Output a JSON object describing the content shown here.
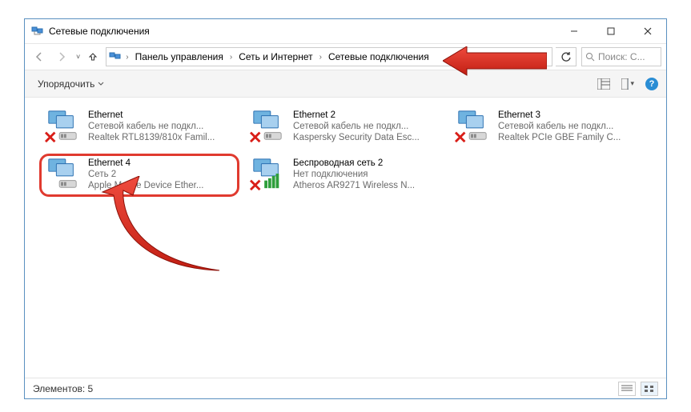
{
  "window": {
    "title": "Сетевые подключения"
  },
  "breadcrumb": {
    "root_sep": "›",
    "items": [
      "Панель управления",
      "Сеть и Интернет",
      "Сетевые подключения"
    ]
  },
  "nav": {
    "refresh_dropdown": "˅"
  },
  "search": {
    "placeholder": "Поиск: С..."
  },
  "toolbar": {
    "organize": "Упорядочить"
  },
  "connections": [
    {
      "name": "Ethernet",
      "status": "Сетевой кабель не подкл...",
      "device": "Realtek RTL8139/810x Famil...",
      "disabled": true,
      "type": "eth"
    },
    {
      "name": "Ethernet 2",
      "status": "Сетевой кабель не подкл...",
      "device": "Kaspersky Security Data Esc...",
      "disabled": true,
      "type": "eth"
    },
    {
      "name": "Ethernet 3",
      "status": "Сетевой кабель не подкл...",
      "device": "Realtek PCIe GBE Family C...",
      "disabled": true,
      "type": "eth"
    },
    {
      "name": "Ethernet 4",
      "status": "Сеть 2",
      "device": "Apple Mobile Device Ether...",
      "disabled": false,
      "type": "eth",
      "highlight": true
    },
    {
      "name": "Беспроводная сеть 2",
      "status": "Нет подключения",
      "device": "Atheros AR9271 Wireless N...",
      "disabled": true,
      "type": "wifi"
    }
  ],
  "statusbar": {
    "count_label": "Элементов: 5"
  }
}
